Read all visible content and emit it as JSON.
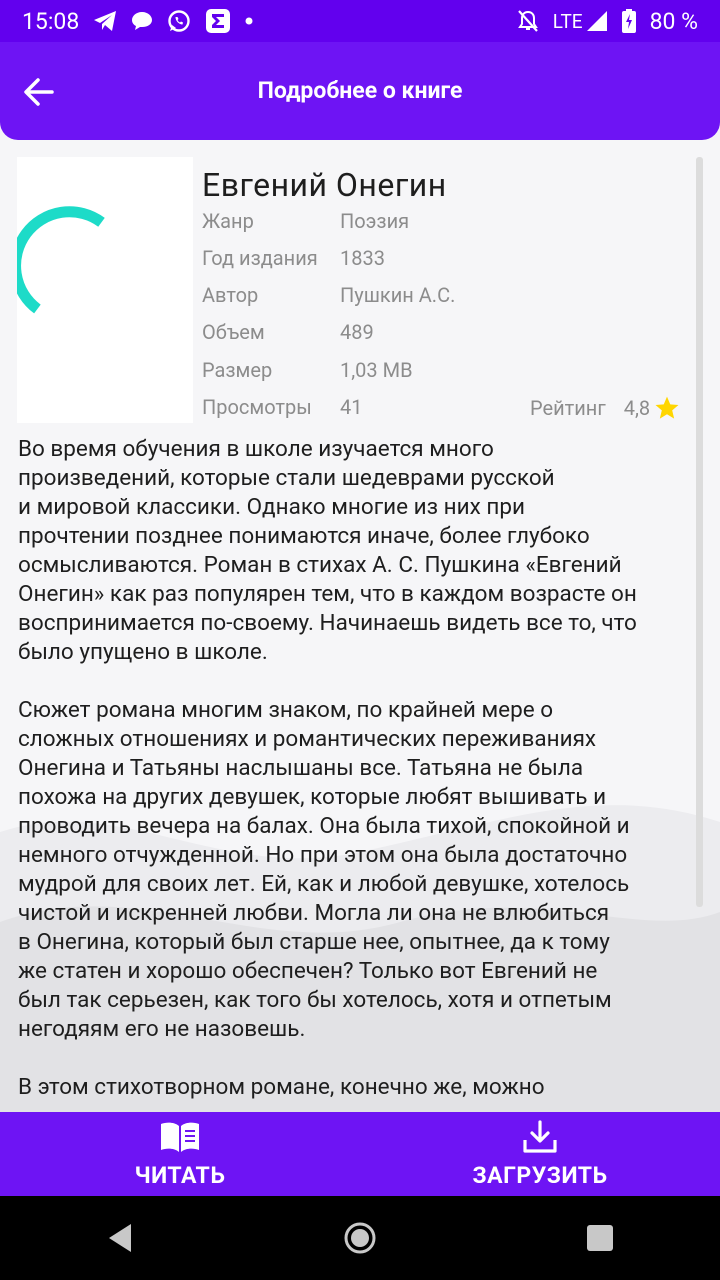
{
  "status": {
    "time": "15:08",
    "network": "LTE",
    "battery": "80 %"
  },
  "header": {
    "title": "Подробнее о книге"
  },
  "book": {
    "title": "Евгений Онегин",
    "fields": [
      {
        "label": "Жанр",
        "value": "Поэзия"
      },
      {
        "label": "Год издания",
        "value": "1833"
      },
      {
        "label": "Автор",
        "value": "Пушкин А.С."
      },
      {
        "label": "Объем",
        "value": "489"
      },
      {
        "label": "Размер",
        "value": "1,03 MB"
      },
      {
        "label": "Просмотры",
        "value": "41"
      }
    ],
    "rating_label": "Рейтинг",
    "rating_value": "4,8",
    "description": "Во время обучения в школе изучается много\nпроизведений, которые стали шедеврами русской\nи мировой классики. Однако многие из них при\nпрочтении позднее понимаются иначе, более глубоко\nосмысливаются. Роман в стихах А. С. Пушкина «Евгений\nОнегин» как раз популярен тем, что в каждом возрасте он\nвоспринимается по-своему. Начинаешь видеть все то, что\nбыло упущено в школе.\n\nСюжет романа многим знаком, по крайней мере о\nсложных отношениях и романтических переживаниях\nОнегина и Татьяны наслышаны все. Татьяна не была\nпохожа на других девушек, которые любят вышивать и\nпроводить вечера на балах. Она была тихой, спокойной и\nнемного отчужденной. Но при этом она была достаточно\nмудрой для своих лет. Ей, как и любой девушке, хотелось\nчистой и искренней любви. Могла ли она не влюбиться\nв Онегина, который был старше нее, опытнее, да к тому\nже статен и хорошо обеспечен? Только вот Евгений не\nбыл так серьезен, как того бы хотелось, хотя и отпетым\nнегодяям его не назовешь.\n\nВ этом стихотворном романе, конечно же, можно"
  },
  "actions": {
    "read_label": "ЧИТАТЬ",
    "download_label": "ЗАГРУЗИТЬ"
  },
  "colors": {
    "primary": "#6e14f4",
    "status_bar": "#6200ee",
    "spinner": "#1ddbc8",
    "star": "#ffd600"
  }
}
